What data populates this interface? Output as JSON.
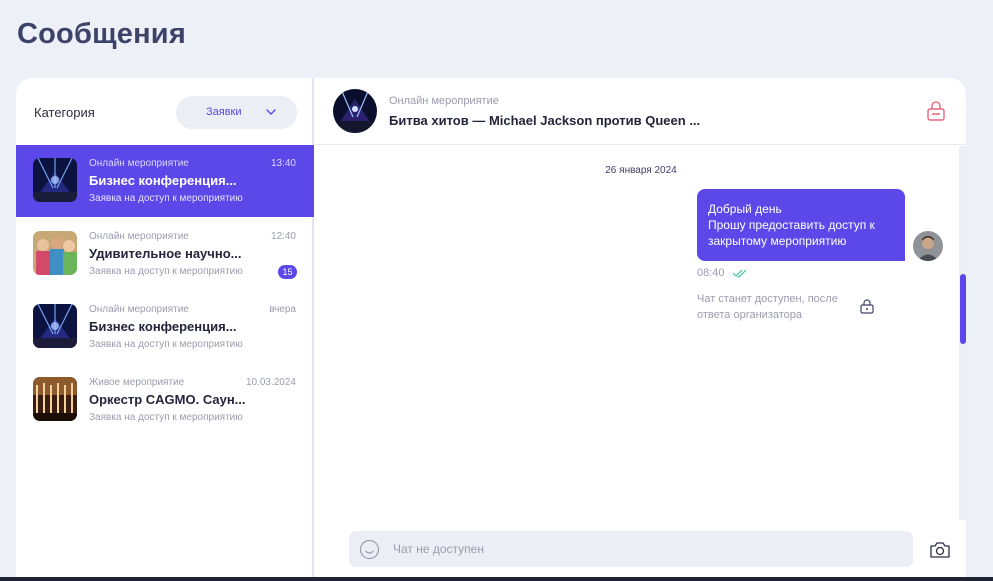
{
  "page": {
    "title": "Сообщения"
  },
  "sidebar": {
    "category_label": "Категория",
    "category_value": "Заявки",
    "conversations": [
      {
        "kind": "Онлайн мероприятие",
        "time": "13:40",
        "name": "Бизнес конференция...",
        "sub": "Заявка на доступ к мероприятию",
        "active": true,
        "badge": ""
      },
      {
        "kind": "Онлайн мероприятие",
        "time": "12:40",
        "name": "Удивительное научно...",
        "sub": "Заявка на доступ к мероприятию",
        "active": false,
        "badge": "15"
      },
      {
        "kind": "Онлайн мероприятие",
        "time": "вчера",
        "name": "Бизнес конференция...",
        "sub": "Заявка на доступ к мероприятию",
        "active": false,
        "badge": ""
      },
      {
        "kind": "Живое мероприятие",
        "time": "10.03.2024",
        "name": "Оркестр CAGMO. Саун...",
        "sub": "Заявка на доступ к мероприятию",
        "active": false,
        "badge": ""
      }
    ]
  },
  "chat": {
    "kind": "Онлайн мероприятие",
    "title": "Битва хитов — Michael Jackson против Queen ...",
    "date": "26 января 2024",
    "message": {
      "lines": [
        "Добрый день",
        "Прошу предоставить доступ к",
        "закрытому мероприятию"
      ],
      "time": "08:40"
    },
    "closed_note": "Чат станет доступен, после ответа организатора",
    "input_placeholder": "Чат не доступен"
  },
  "colors": {
    "accent": "#5c48e8",
    "lock": "#e8677a",
    "background": "#eef0f8"
  },
  "icons": [
    "chevron-down-icon",
    "lock-icon",
    "double-check-icon",
    "smile-icon",
    "camera-icon"
  ]
}
